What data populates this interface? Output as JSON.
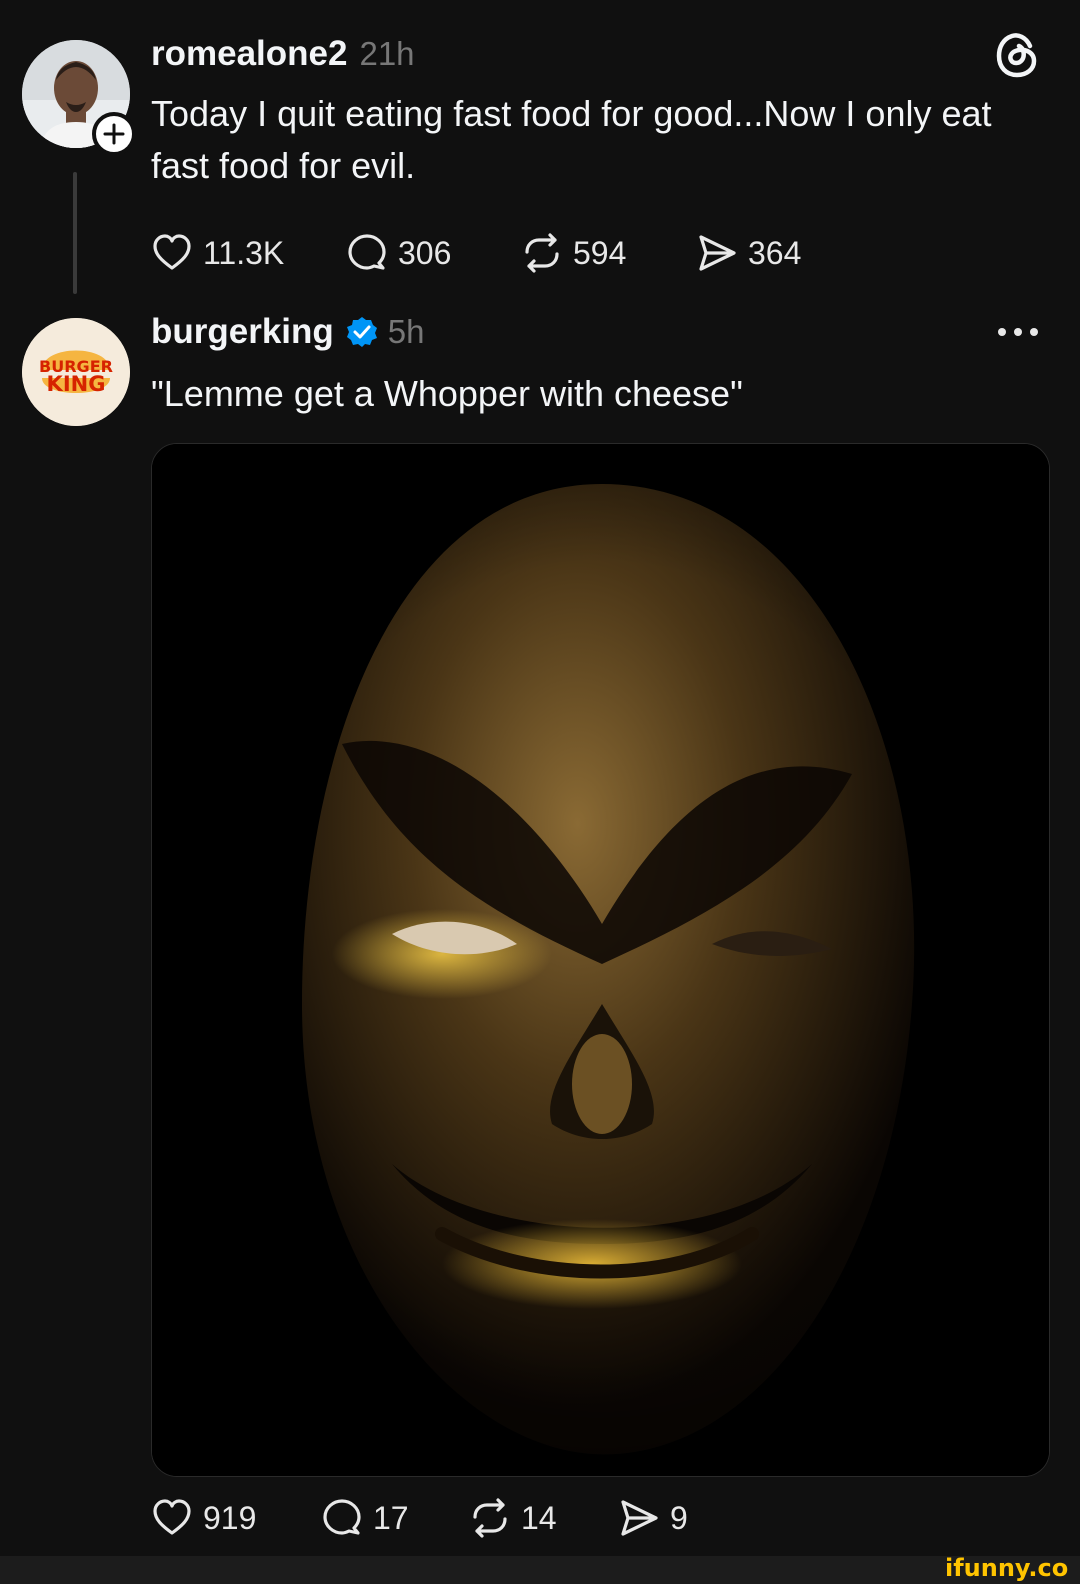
{
  "post": {
    "username": "romealone2",
    "time": "21h",
    "text": "Today I quit eating fast food for good...Now I only eat fast food for evil.",
    "likes": "11.3K",
    "replies": "306",
    "reposts": "594",
    "shares": "364",
    "app_icon": "threads-logo-icon"
  },
  "reply": {
    "username": "burgerking",
    "verified_icon": "verified-badge-icon",
    "time": "5h",
    "avatar_logo_line1": "BURGER",
    "avatar_logo_line2": "KING",
    "text": "\"Lemme get a Whopper with cheese\"",
    "likes": "919",
    "replies": "17",
    "reposts": "14",
    "shares": "9",
    "menu_icon": "more-options-icon"
  },
  "watermark": "ifunny.co",
  "colors": {
    "background": "#101010",
    "text": "#f3f5f7",
    "muted": "#777777",
    "verified": "#0095f6",
    "bk_orange": "#d62300",
    "bk_bun": "#f5b541",
    "watermark": "#ffc400"
  }
}
